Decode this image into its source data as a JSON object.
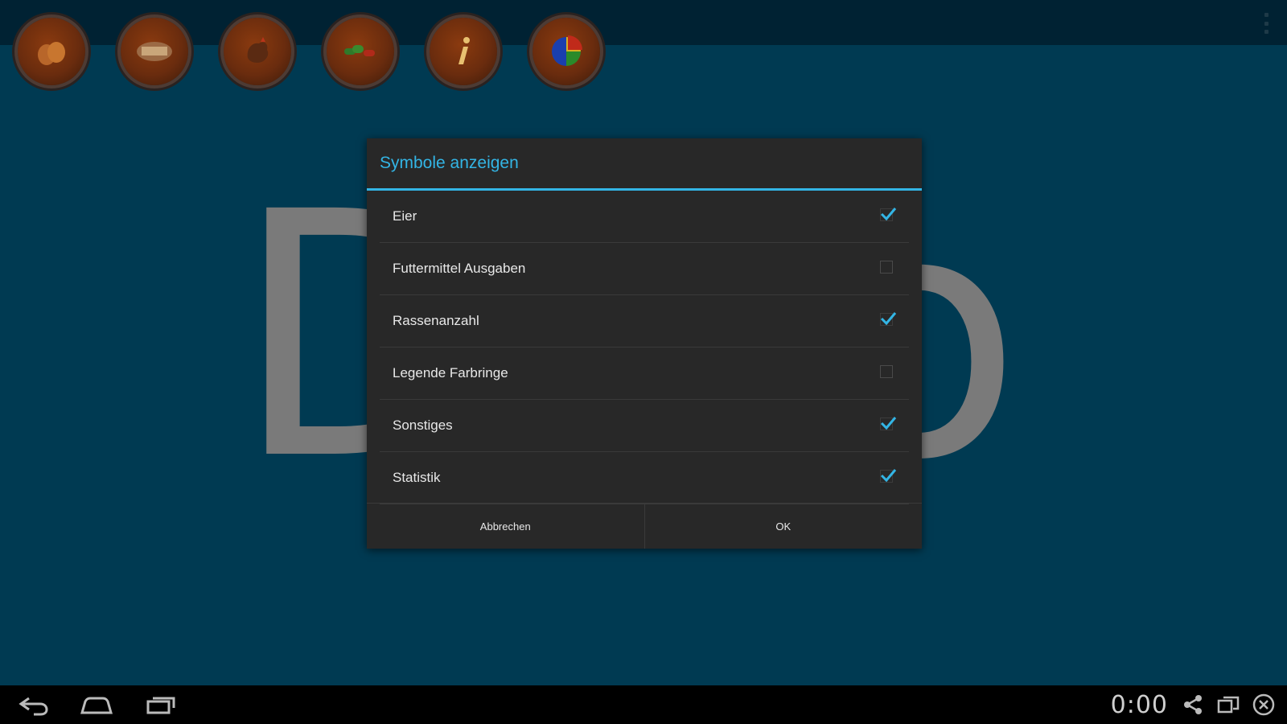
{
  "app": {
    "background_color": "#003a52",
    "watermark_text": "Do"
  },
  "toolbar": {
    "icons": [
      {
        "name": "eggs-icon"
      },
      {
        "name": "feed-icon"
      },
      {
        "name": "chicken-icon"
      },
      {
        "name": "legend-icon"
      },
      {
        "name": "info-icon"
      },
      {
        "name": "statistics-icon"
      }
    ],
    "overflow_icon": "overflow-menu-icon"
  },
  "dialog": {
    "title": "Symbole anzeigen",
    "accent_color": "#33b5e5",
    "items": [
      {
        "label": "Eier",
        "checked": true
      },
      {
        "label": "Futtermittel Ausgaben",
        "checked": false
      },
      {
        "label": "Rassenanzahl",
        "checked": true
      },
      {
        "label": "Legende Farbringe",
        "checked": false
      },
      {
        "label": "Sonstiges",
        "checked": true
      },
      {
        "label": "Statistik",
        "checked": true
      }
    ],
    "cancel_label": "Abbrechen",
    "ok_label": "OK"
  },
  "navbar": {
    "back_icon": "back-icon",
    "home_icon": "home-icon",
    "recents_icon": "recent-apps-icon",
    "clock": "0:00",
    "status_icons": [
      "share-icon",
      "window-icon",
      "close-icon"
    ]
  }
}
